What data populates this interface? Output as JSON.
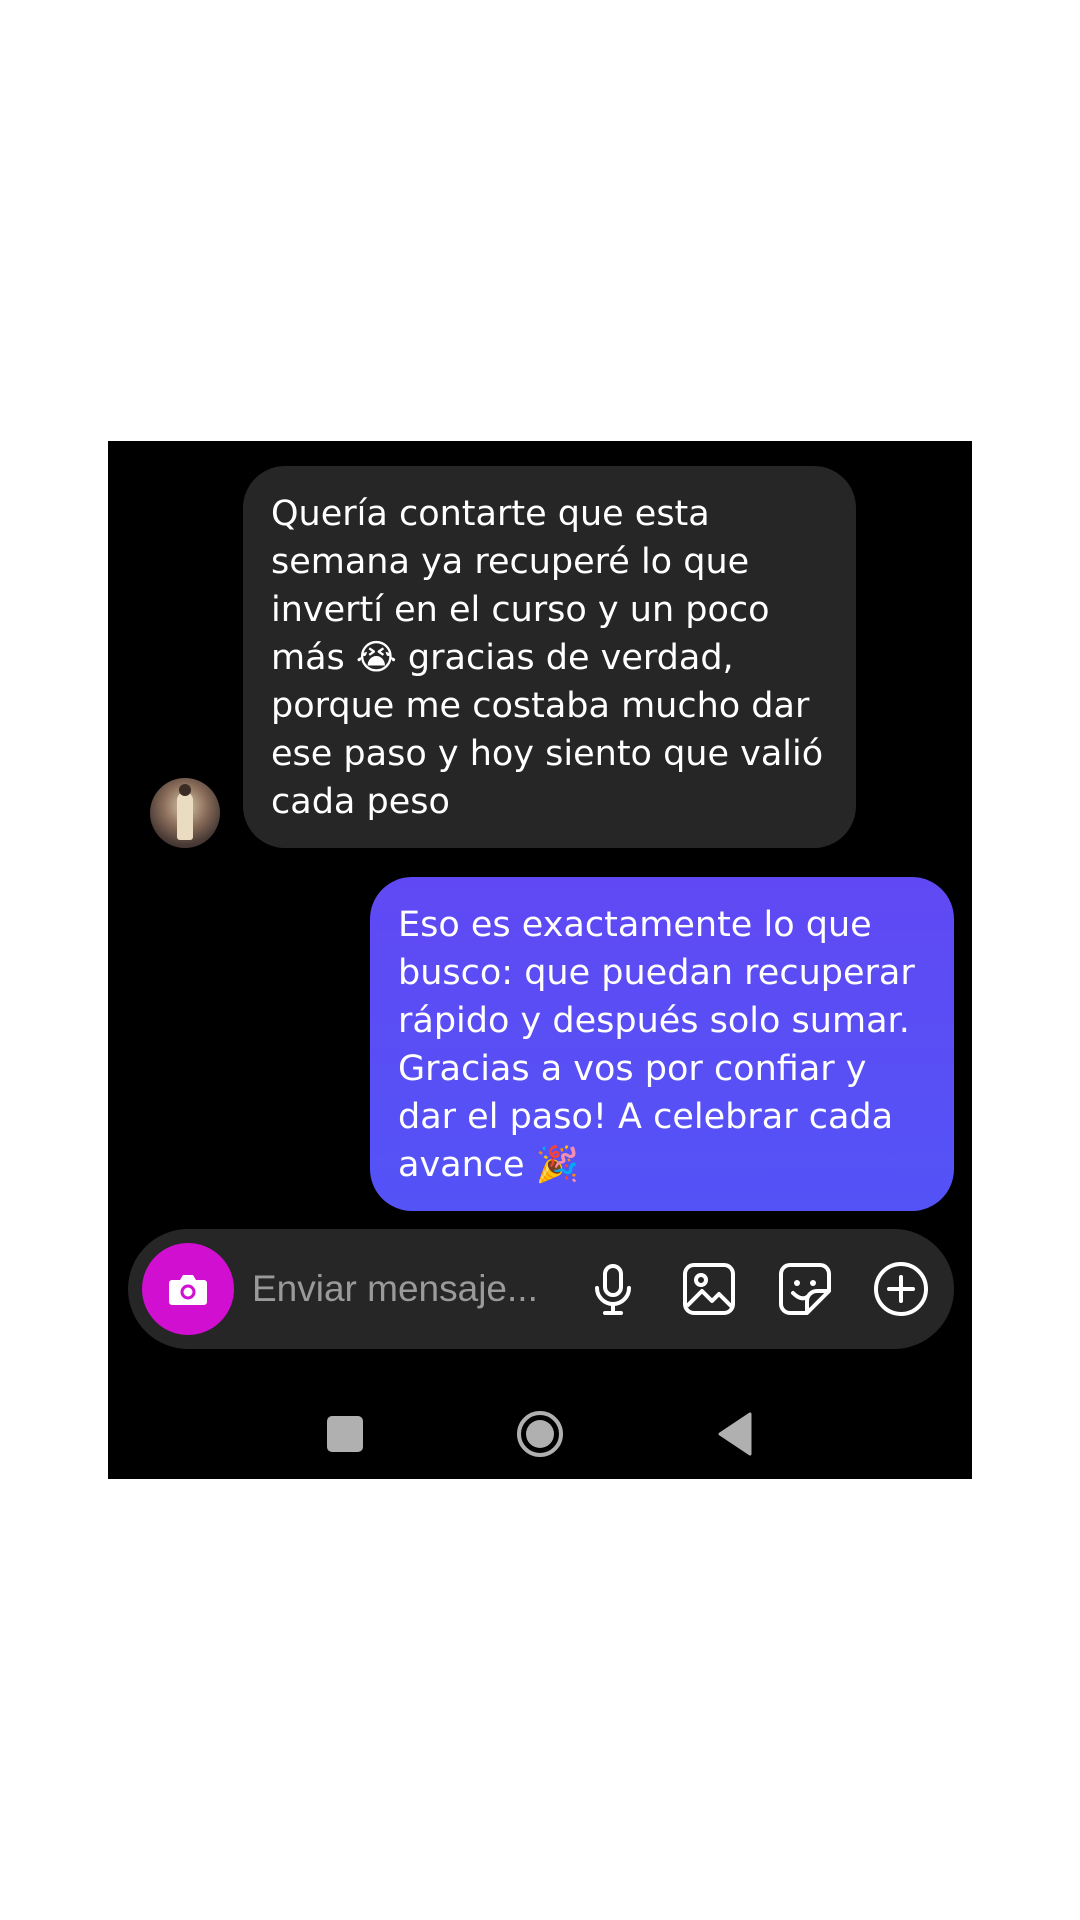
{
  "conversation": {
    "messages": [
      {
        "direction": "received",
        "text": "Quería contarte que esta semana ya recuperé lo que invertí en el curso y un poco más 😭 gracias de verdad, porque me costaba mucho dar ese paso y hoy siento que valió cada peso"
      },
      {
        "direction": "sent",
        "text": "Eso es exactamente lo que busco: que puedan recuperar rápido y después solo sumar. Gracias a vos por confiar y dar el paso! A celebrar cada avance 🎉"
      }
    ]
  },
  "composer": {
    "placeholder": "Enviar mensaje...",
    "icons": [
      "camera-icon",
      "microphone-icon",
      "image-icon",
      "sticker-icon",
      "plus-circle-icon"
    ],
    "camera_button_color": "#d10fd1"
  },
  "navigation": {
    "icons": [
      "recents-square-icon",
      "home-circle-icon",
      "back-triangle-icon"
    ]
  },
  "colors": {
    "background": "#000000",
    "received_bubble": "#262626",
    "sent_bubble": "#5a4ff5",
    "text": "#ffffff"
  }
}
